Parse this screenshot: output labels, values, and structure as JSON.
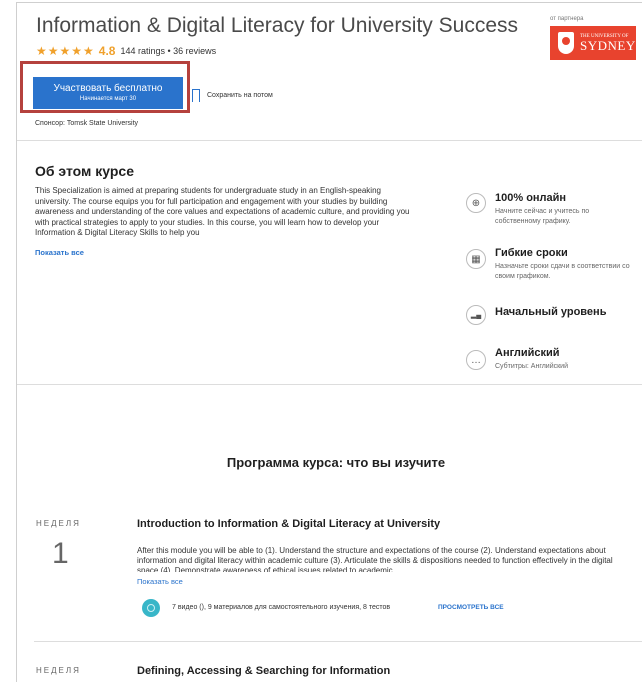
{
  "course": {
    "title": "Information & Digital Literacy for University Success",
    "stars": "★★★★★",
    "score": "4.8",
    "ratings": "144 ratings • 36 reviews",
    "rating_value": 4.8
  },
  "partner": {
    "label": "от партнера",
    "logo_small": "THE UNIVERSITY OF",
    "logo_big": "SYDNEY",
    "color": "#e8432e"
  },
  "enroll": {
    "label": "Участвовать бесплатно",
    "sublabel": "Начинается март 30",
    "color": "#2a73cc",
    "highlight_color": "#b5413d"
  },
  "save_later": "Сохранить на потом",
  "sponsor": "Спонсор: Tomsk State University",
  "about": {
    "title": "Об этом курсе",
    "text": "This Specialization is aimed at preparing students for undergraduate study in an English-speaking university. The course equips you for full participation and engagement with your studies by building awareness and understanding of the core values and expectations of academic culture, and providing you with practical strategies to apply to your studies. In this course, you will learn how to develop your Information & Digital Literacy Skills to help you",
    "show_all": "Показать все"
  },
  "features": [
    {
      "icon": "globe-icon",
      "glyph": "⊕",
      "title": "100% онлайн",
      "sub": "Начните сейчас и учитесь по собственному графику."
    },
    {
      "icon": "calendar-icon",
      "glyph": "▦",
      "title": "Гибкие сроки",
      "sub": "Назначьте сроки сдачи в соответствии со своим графиком."
    },
    {
      "icon": "level-icon",
      "glyph": "▂▄",
      "title": "Начальный уровень",
      "sub": ""
    },
    {
      "icon": "speech-icon",
      "glyph": "…",
      "title": "Английский",
      "sub": "Субтитры: Английский"
    }
  ],
  "program_title": "Программа курса: что вы изучите",
  "weeks": [
    {
      "label": "НЕДЕЛЯ",
      "number": "1",
      "title": "Introduction to Information & Digital Literacy at University",
      "desc": "After this module you will be able to (1). Understand the structure and expectations of the course (2). Understand expectations about information and digital literacy within academic culture (3). Articulate the skills & dispositions needed to function effectively in the digital space (4). Demonstrate awareness of ethical issues related to academic",
      "show_all": "Показать все",
      "meta": "7 видео (), 9 материалов для самостоятельного изучения, 8 тестов",
      "view_all": "ПРОСМОТРЕТЬ ВСЕ"
    },
    {
      "label": "НЕДЕЛЯ",
      "title": "Defining, Accessing & Searching for Information"
    }
  ]
}
